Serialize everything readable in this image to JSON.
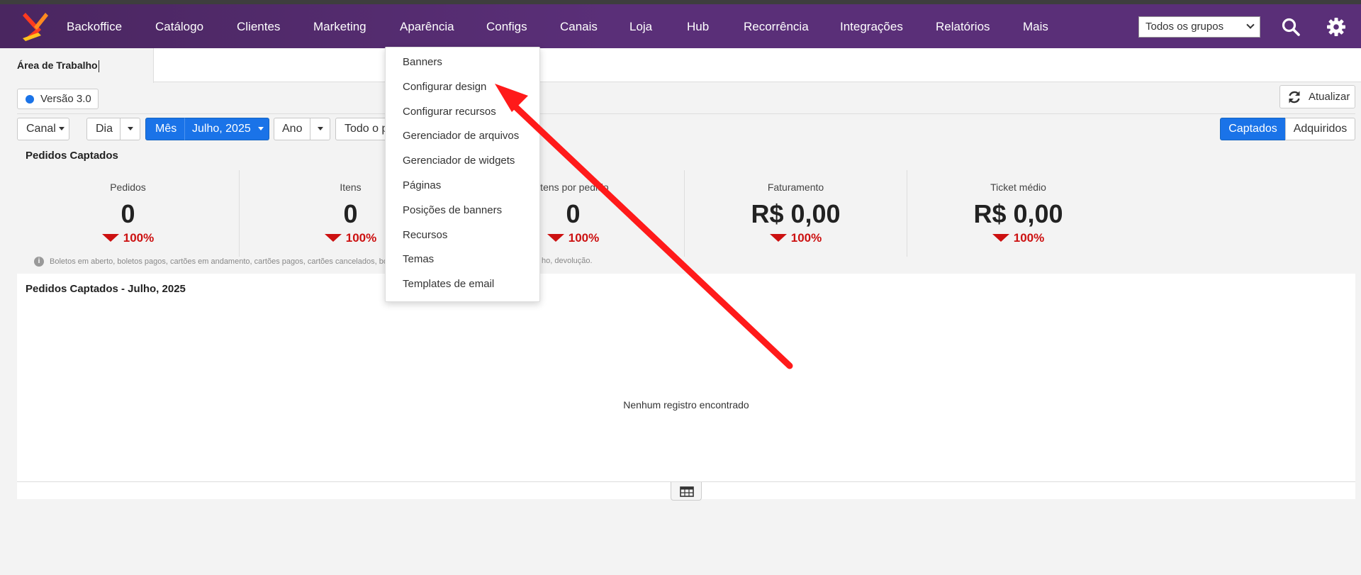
{
  "nav": {
    "items": [
      "Backoffice",
      "Catálogo",
      "Clientes",
      "Marketing",
      "Aparência",
      "Configs",
      "Canais",
      "Loja",
      "Hub",
      "Recorrência",
      "Integrações",
      "Relatórios",
      "Mais"
    ],
    "group_select": "Todos os grupos",
    "icons": [
      "search-icon",
      "gear-icon"
    ]
  },
  "tab": {
    "active_label": "Área de Trabalho"
  },
  "version": {
    "label": "Versão 3.0"
  },
  "refresh": {
    "label": "Atualizar"
  },
  "filters": {
    "canal": "Canal",
    "dia": "Dia",
    "mes": "Mês",
    "mes_value": "Julho, 2025",
    "ano": "Ano",
    "periodo": "Todo o p",
    "captados": "Captados",
    "adquiridos": "Adquiridos"
  },
  "summary": {
    "title": "Pedidos Captados",
    "kpis": [
      {
        "label": "Pedidos",
        "value": "0",
        "change": "100%"
      },
      {
        "label": "Itens",
        "value": "0",
        "change": "100%"
      },
      {
        "label": "Itens por pedido",
        "value": "0",
        "change": "100%"
      },
      {
        "label": "Faturamento",
        "value": "R$ 0,00",
        "change": "100%"
      },
      {
        "label": "Ticket médio",
        "value": "R$ 0,00",
        "change": "100%"
      }
    ],
    "note": "Boletos em aberto, boletos pagos, cartões em andamento, cartões pagos, cartões cancelados, bo",
    "note_tail": "ho, devolução."
  },
  "chart_panel": {
    "title": "Pedidos Captados - Julho, 2025",
    "empty_message": "Nenhum registro encontrado"
  },
  "dropdown": {
    "items": [
      "Banners",
      "Configurar design",
      "Configurar recursos",
      "Gerenciador de arquivos",
      "Gerenciador de widgets",
      "Páginas",
      "Posições de banners",
      "Recursos",
      "Temas",
      "Templates de email"
    ]
  },
  "colors": {
    "nav_bg": "#5a2f78",
    "primary": "#1a73e8",
    "negative": "#cc1111",
    "annotation_arrow": "#ff1a1a"
  }
}
